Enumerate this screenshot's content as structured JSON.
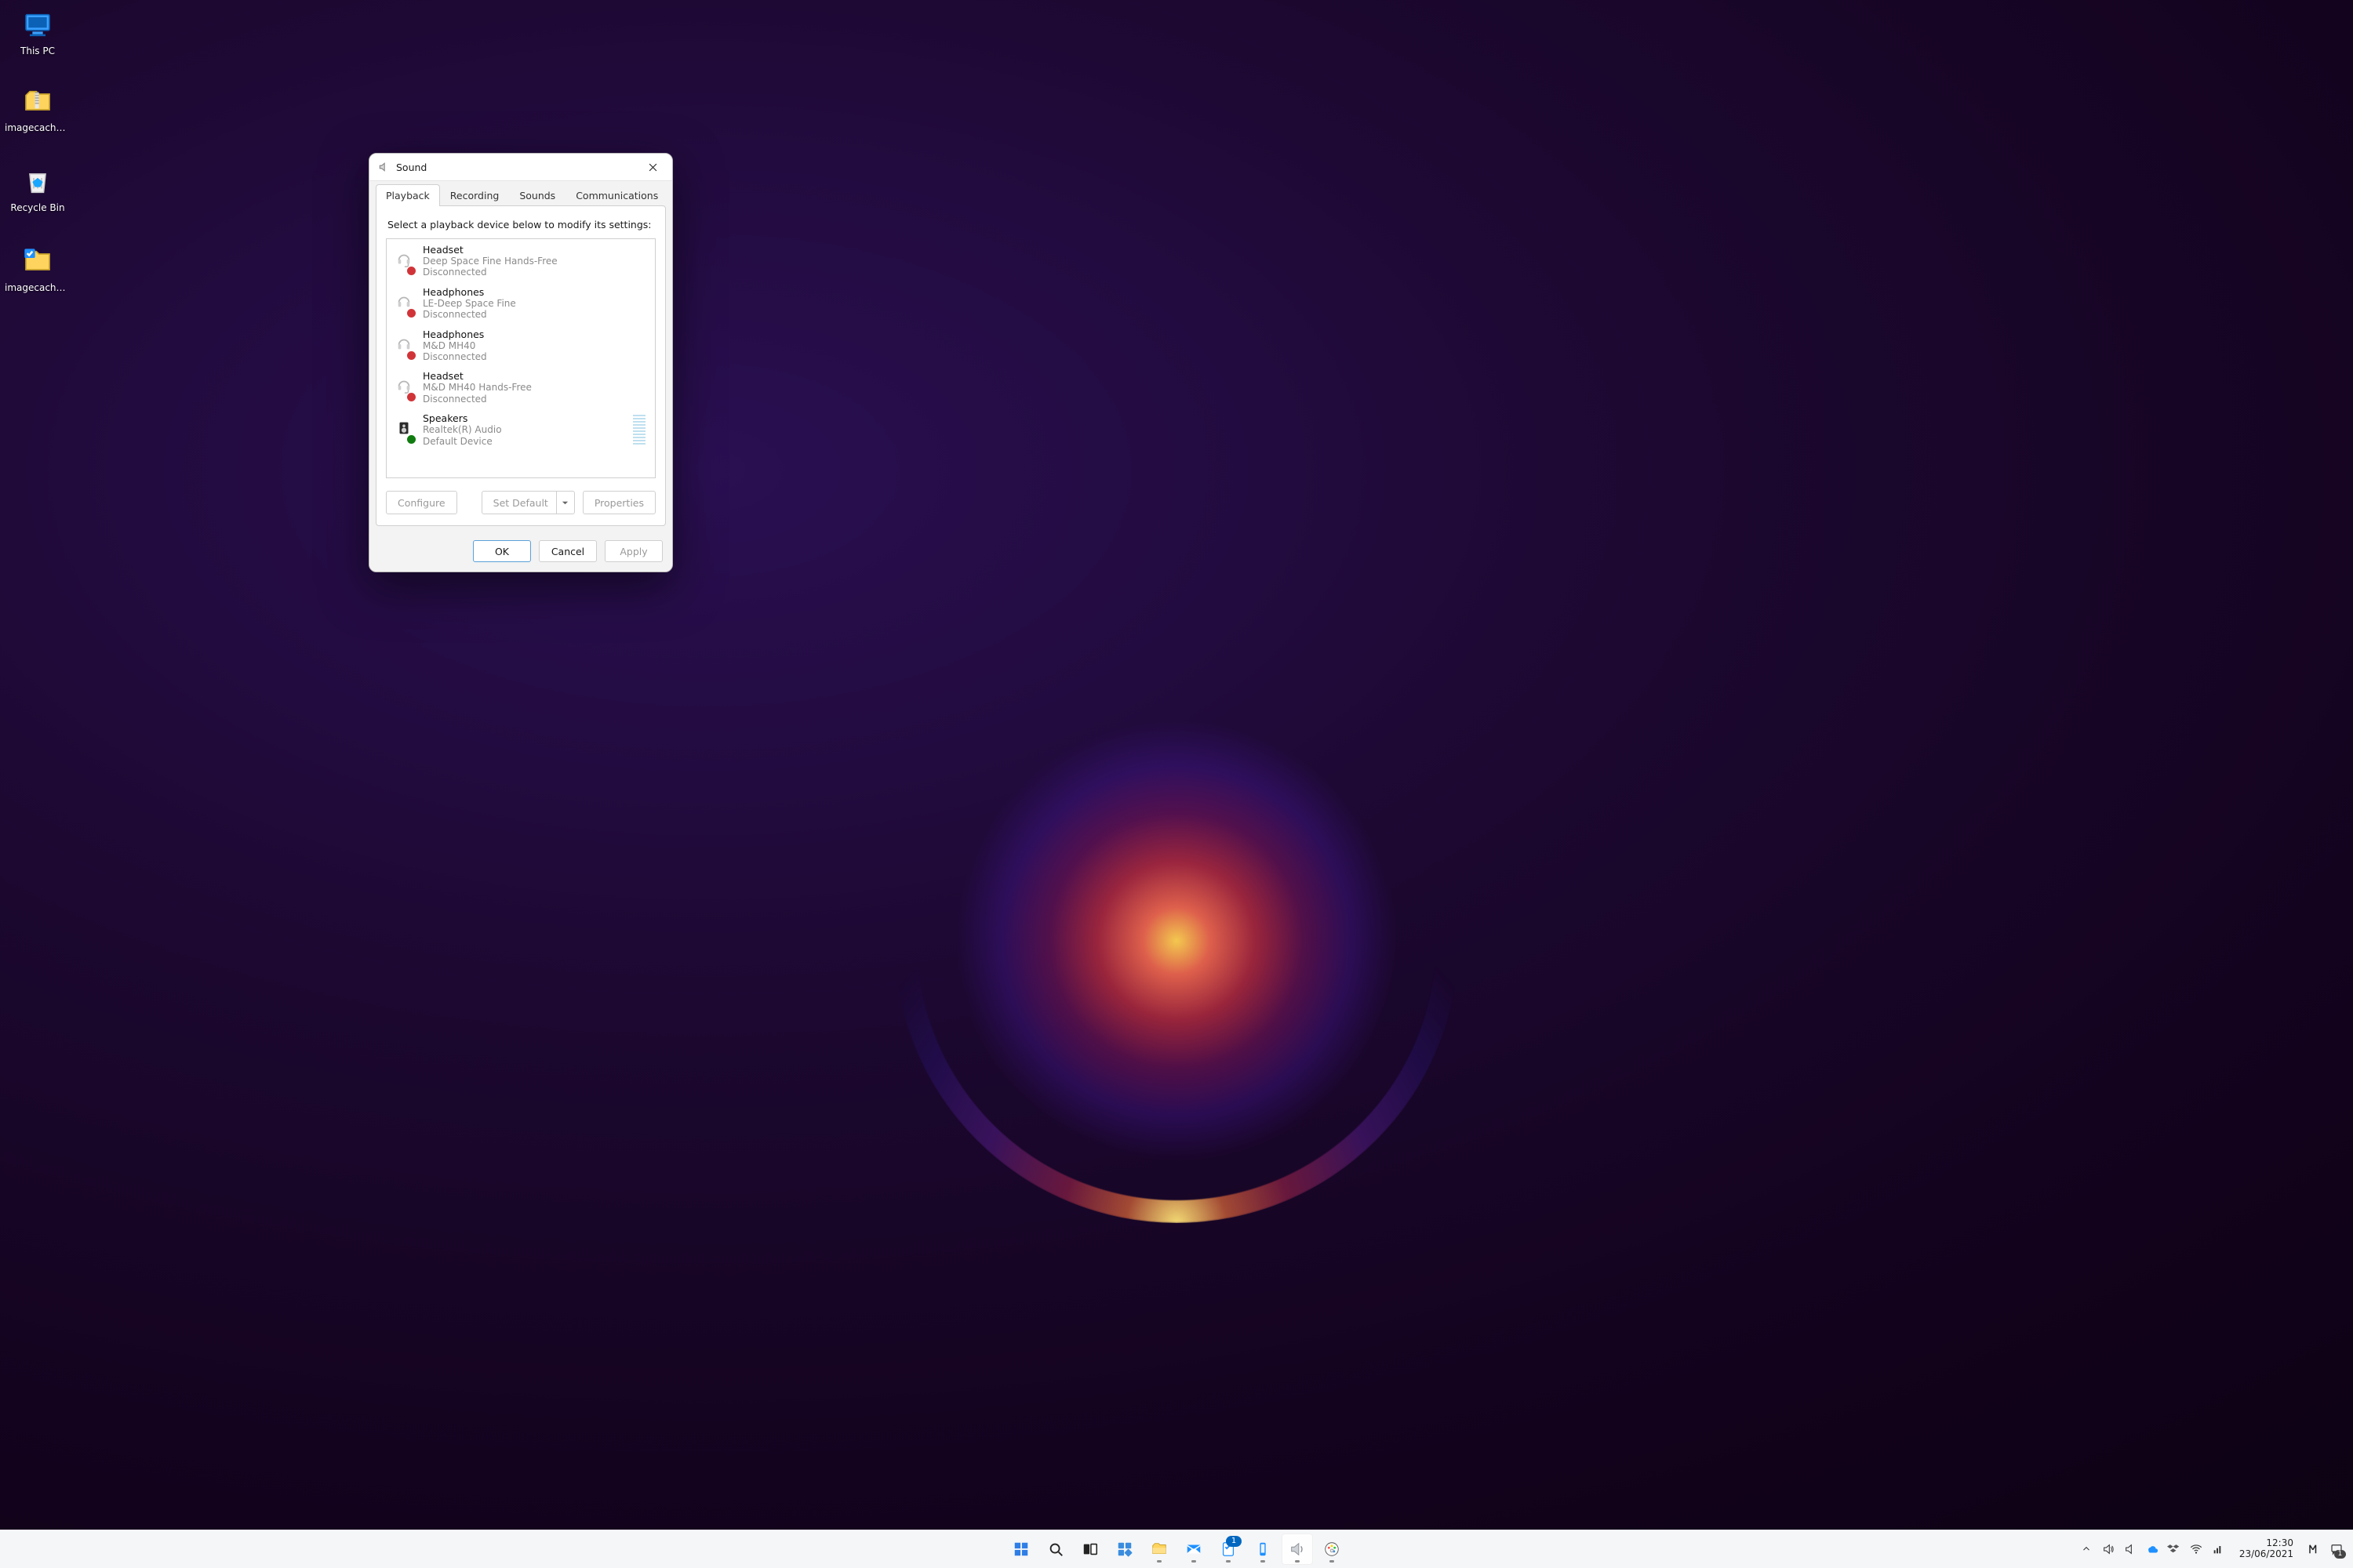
{
  "desktop": {
    "icons": [
      {
        "name": "this-pc",
        "label": "This PC",
        "kind": "computer"
      },
      {
        "name": "imagecache-zip",
        "label": "imagecache...",
        "kind": "zip"
      },
      {
        "name": "recycle-bin",
        "label": "Recycle Bin",
        "kind": "recycle"
      },
      {
        "name": "imagecache-folder",
        "label": "imagecache...",
        "kind": "folder-check"
      }
    ]
  },
  "dialog": {
    "title": "Sound",
    "tabs": [
      "Playback",
      "Recording",
      "Sounds",
      "Communications"
    ],
    "active_tab_index": 0,
    "instruction": "Select a playback device below to modify its settings:",
    "devices": [
      {
        "title": "Headset",
        "subtitle": "Deep Space Fine Hands-Free",
        "status": "Disconnected",
        "icon": "headset",
        "badge": "red"
      },
      {
        "title": "Headphones",
        "subtitle": "LE-Deep Space Fine",
        "status": "Disconnected",
        "icon": "headphones",
        "badge": "red"
      },
      {
        "title": "Headphones",
        "subtitle": "M&D MH40",
        "status": "Disconnected",
        "icon": "headphones",
        "badge": "red"
      },
      {
        "title": "Headset",
        "subtitle": "M&D MH40 Hands-Free",
        "status": "Disconnected",
        "icon": "headset",
        "badge": "red"
      },
      {
        "title": "Speakers",
        "subtitle": "Realtek(R) Audio",
        "status": "Default Device",
        "icon": "speaker",
        "badge": "green",
        "meter": true
      }
    ],
    "buttons": {
      "configure": "Configure",
      "set_default": "Set Default",
      "properties": "Properties",
      "ok": "OK",
      "cancel": "Cancel",
      "apply": "Apply"
    }
  },
  "taskbar": {
    "center": [
      {
        "name": "start",
        "icon": "winlogo"
      },
      {
        "name": "search",
        "icon": "search"
      },
      {
        "name": "task-view",
        "icon": "taskview"
      },
      {
        "name": "widgets",
        "icon": "widgets"
      },
      {
        "name": "file-explorer",
        "icon": "explorer",
        "running": true
      },
      {
        "name": "mail",
        "icon": "mail",
        "running": true
      },
      {
        "name": "todo",
        "icon": "todo",
        "running": true,
        "badge": "1"
      },
      {
        "name": "your-phone",
        "icon": "phone",
        "running": true
      },
      {
        "name": "sound-cpl",
        "icon": "soundcpl",
        "running": true,
        "active": true
      },
      {
        "name": "paint",
        "icon": "paint",
        "running": true
      }
    ],
    "tray": {
      "overflow": true,
      "icons": [
        "volume",
        "speaker-tray",
        "onedrive",
        "dropbox",
        "wifi",
        "network"
      ],
      "time": "12:30",
      "date": "23/06/2021",
      "extra": [
        "monitor-app",
        "action-center"
      ],
      "action_center_badge": "1"
    }
  }
}
